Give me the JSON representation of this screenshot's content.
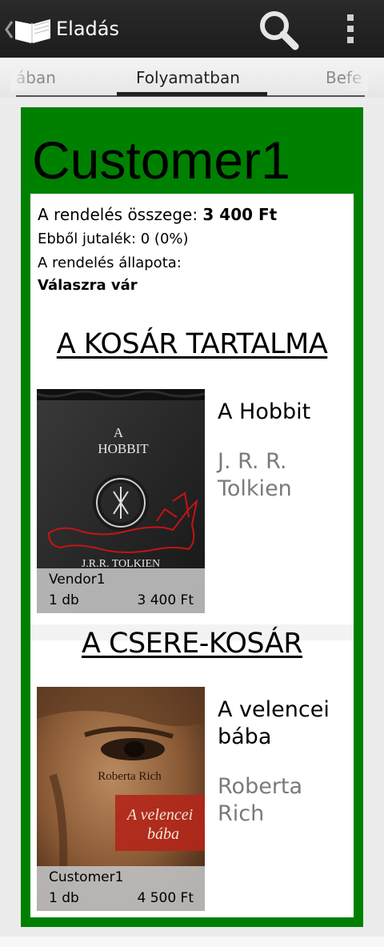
{
  "actionbar": {
    "title": "Eladás",
    "icons": [
      "up-caret-icon",
      "books-app-icon",
      "search-icon",
      "overflow-menu-icon"
    ]
  },
  "tabs": {
    "left": "ában",
    "center": "Folyamatban",
    "right": "Befe"
  },
  "order": {
    "customer": "Customer1",
    "total_label": "A rendelés összege:",
    "total_value": "3 400 Ft",
    "commission": "Ebből jutalék: 0 (0%)",
    "status_label": "A rendelés állapota:",
    "status_value": "Válaszra vár"
  },
  "sections": {
    "cart_heading": "A KOSÁR TARTALMA",
    "swap_heading": "A CSERE-KOSÁR"
  },
  "cart_items": [
    {
      "title": "A Hobbit",
      "author": "J. R. R. Tolkien",
      "seller": "Vendor1",
      "qty": "1 db",
      "price": "3 400 Ft",
      "cover": {
        "line1": "A",
        "line2": "HOBBIT",
        "author": "J.R.R. TOLKIEN"
      }
    }
  ],
  "swap_items": [
    {
      "title": "A velencei bába",
      "author": "Roberta Rich",
      "seller": "Customer1",
      "qty": "1 db",
      "price": "4 500 Ft",
      "cover": {
        "author": "Roberta Rich",
        "title_line1": "A velencei",
        "title_line2": "bába"
      }
    }
  ],
  "colors": {
    "card": "#008000",
    "actionbar": "#1f1f1f",
    "tab_indicator": "#222222"
  }
}
